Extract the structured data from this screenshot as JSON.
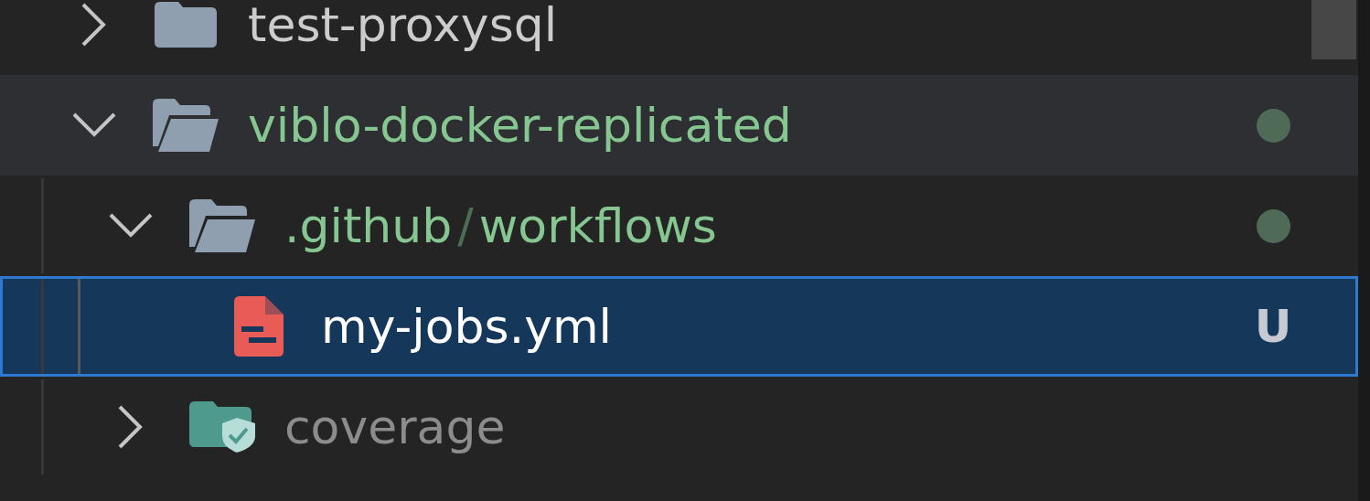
{
  "tree": [
    {
      "kind": "folder",
      "label": "test-proxysql",
      "color": "#cccccc",
      "expanded": false,
      "hovered": false,
      "selected": false
    },
    {
      "kind": "folder",
      "label": "viblo-docker-replicated",
      "color": "#86c691",
      "expanded": true,
      "hovered": true,
      "selected": false,
      "decoration": {
        "kind": "dot",
        "color": "#4f6b58"
      },
      "children": [
        {
          "kind": "compound",
          "segments": [
            ".github",
            "workflows"
          ],
          "separator": "/",
          "color": "#86c691",
          "expanded": true,
          "hovered": false,
          "selected": false,
          "decoration": {
            "kind": "dot",
            "color": "#4f6b58"
          },
          "children": [
            {
              "kind": "file",
              "label": "my-jobs.yml",
              "color": "#ffffff",
              "selected": true,
              "decoration": {
                "kind": "letter",
                "text": "U"
              }
            }
          ]
        },
        {
          "kind": "protected",
          "label": "coverage",
          "color": "#8c8c8c",
          "expanded": false,
          "hovered": false,
          "selected": false
        }
      ]
    }
  ]
}
